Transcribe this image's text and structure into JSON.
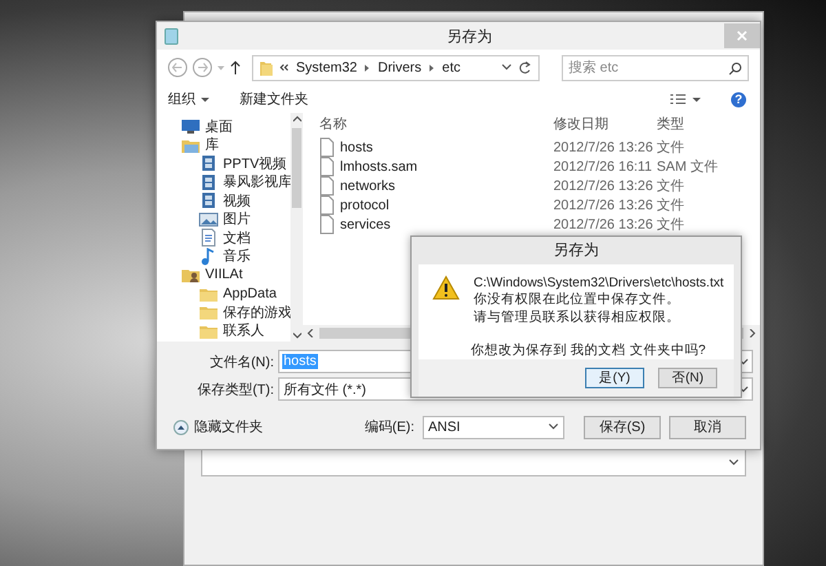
{
  "save_dialog": {
    "title": "另存为",
    "nav": {
      "path": [
        "System32",
        "Drivers",
        "etc"
      ],
      "search": {
        "placeholder": "搜索 etc"
      }
    },
    "toolbar": {
      "organize": "组织",
      "new_folder": "新建文件夹",
      "help": "?"
    },
    "sidebar": {
      "items": [
        {
          "label": "桌面",
          "kind": "desktop"
        },
        {
          "label": "库",
          "kind": "library",
          "children": [
            {
              "label": "PPTV视频",
              "kind": "video"
            },
            {
              "label": "暴风影视库",
              "kind": "video"
            },
            {
              "label": "视频",
              "kind": "video"
            },
            {
              "label": "图片",
              "kind": "picture"
            },
            {
              "label": "文档",
              "kind": "document"
            },
            {
              "label": "音乐",
              "kind": "music"
            }
          ]
        },
        {
          "label": "VIILAt",
          "kind": "user",
          "children": [
            {
              "label": "AppData",
              "kind": "folder"
            },
            {
              "label": "保存的游戏",
              "kind": "folder"
            },
            {
              "label": "联系人",
              "kind": "folder"
            }
          ]
        }
      ]
    },
    "table": {
      "columns": [
        "名称",
        "修改日期",
        "类型"
      ],
      "rows": [
        {
          "name": "hosts",
          "date": "2012/7/26 13:26",
          "type": "文件"
        },
        {
          "name": "lmhosts.sam",
          "date": "2012/7/26 16:11",
          "type": "SAM 文件"
        },
        {
          "name": "networks",
          "date": "2012/7/26 13:26",
          "type": "文件"
        },
        {
          "name": "protocol",
          "date": "2012/7/26 13:26",
          "type": "文件"
        },
        {
          "name": "services",
          "date": "2012/7/26 13:26",
          "type": "文件"
        }
      ]
    },
    "filename": {
      "label": "文件名(N):",
      "value": "hosts",
      "value_selected": true
    },
    "filetype": {
      "label": "保存类型(T):",
      "value": "所有文件 (*.*)"
    },
    "hide_folders": "隐藏文件夹",
    "encoding": {
      "label": "编码(E):",
      "value": "ANSI"
    },
    "buttons": [
      {
        "label": "保存(S)"
      },
      {
        "label": "取消"
      }
    ]
  },
  "alert": {
    "title": "另存为",
    "lines": [
      "C:\\Windows\\System32\\Drivers\\etc\\hosts.txt",
      "你没有权限在此位置中保存文件。",
      "请与管理员联系以获得相应权限。"
    ],
    "question": "你想改为保存到 我的文档 文件夹中吗?",
    "buttons": [
      {
        "label": "是(Y)",
        "default": true
      },
      {
        "label": "否(N)",
        "default": false
      }
    ]
  }
}
